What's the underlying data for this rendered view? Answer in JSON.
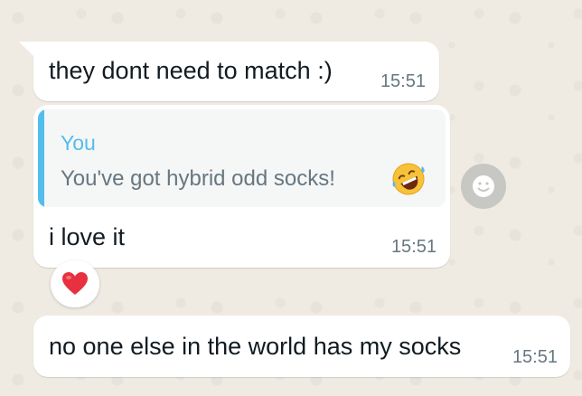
{
  "messages": [
    {
      "text": "they dont need to match :)",
      "time": "15:51"
    },
    {
      "quote": {
        "author": "You",
        "text": "You've got hybrid odd socks!",
        "emoji": "rolling-on-floor-laughing-emoji"
      },
      "text": "i love it",
      "time": "15:51",
      "reaction": "red-heart-emoji"
    },
    {
      "text": "no one else in the world has my socks",
      "time": "15:51"
    }
  ],
  "colors": {
    "background": "#efeae2",
    "bubble": "#ffffff",
    "quote_accent": "#53bdeb",
    "timestamp": "#667781",
    "heart": "#e8313f"
  }
}
